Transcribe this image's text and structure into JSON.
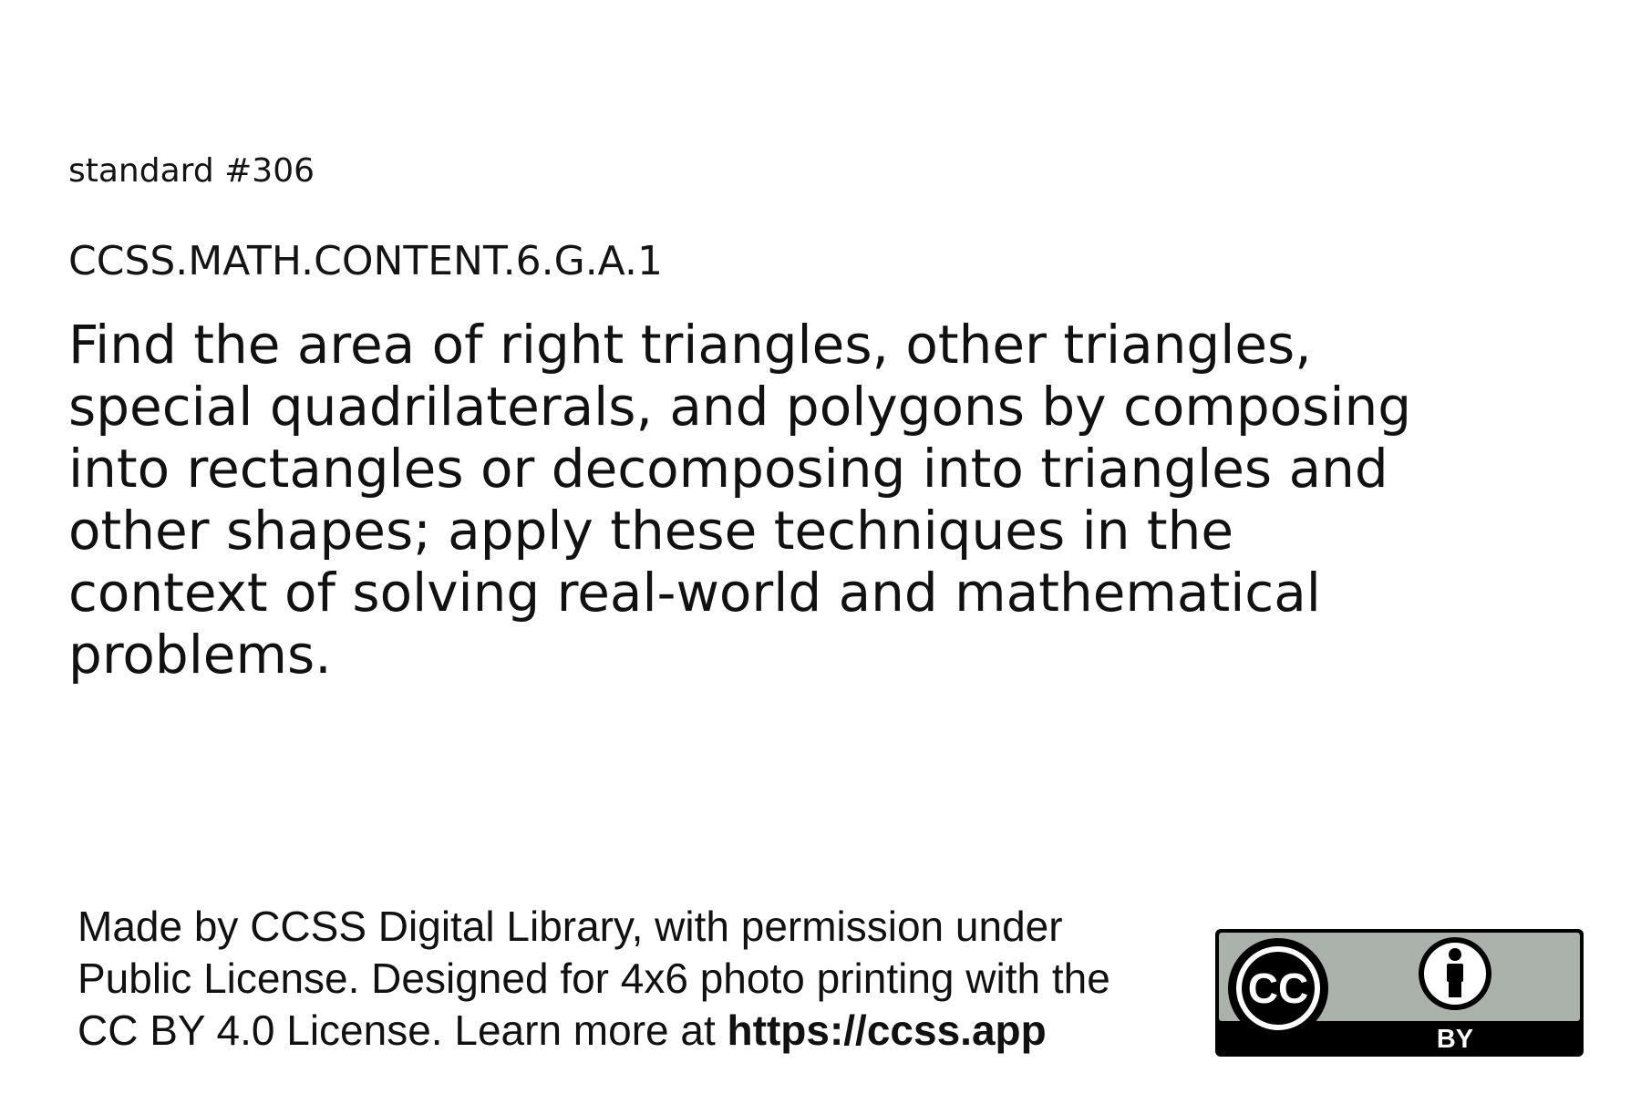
{
  "standard_number": "standard #306",
  "standard_code": "CCSS.MATH.CONTENT.6.G.A.1",
  "standard_text": "Find the area of right triangles, other triangles, special quadrilaterals, and polygons by composing into rectangles or decomposing into triangles and other shapes; apply these techniques in the context of solving real-world and mathematical problems.",
  "footer": {
    "text": "Made by CCSS Digital Library, with permission under Public License. Designed for 4x6 photo printing with the CC BY 4.0 License. Learn more at",
    "url": "https://ccss.app"
  },
  "license_badge": {
    "cc_label": "CC",
    "by_label": "BY",
    "cc_icon": "cc-icon",
    "attribution_icon": "attribution-person-icon",
    "colors": {
      "badge_gray": "#aab2ab",
      "badge_black": "#000000",
      "badge_white": "#ffffff"
    }
  }
}
